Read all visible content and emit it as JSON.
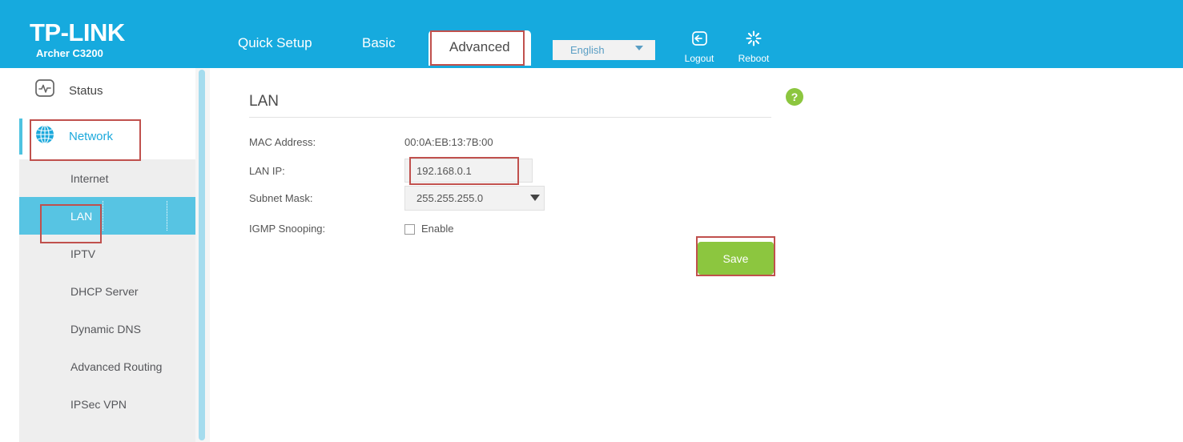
{
  "header": {
    "brand": "TP-LINK",
    "model": "Archer C3200",
    "tabs": [
      {
        "label": "Quick Setup",
        "active": false
      },
      {
        "label": "Basic",
        "active": false
      },
      {
        "label": "Advanced",
        "active": true
      }
    ],
    "language": {
      "selected": "English",
      "icon": "chevron-down-icon"
    },
    "actions": [
      {
        "label": "Logout",
        "icon": "logout-icon"
      },
      {
        "label": "Reboot",
        "icon": "reboot-icon"
      }
    ]
  },
  "sidebar": {
    "main_items": [
      {
        "label": "Status",
        "icon": "status-monitor-icon",
        "selected": false
      },
      {
        "label": "Network",
        "icon": "globe-icon",
        "selected": true
      }
    ],
    "sub_items": [
      {
        "label": "Internet",
        "active": false
      },
      {
        "label": "LAN",
        "active": true
      },
      {
        "label": "IPTV",
        "active": false
      },
      {
        "label": "DHCP Server",
        "active": false
      },
      {
        "label": "Dynamic DNS",
        "active": false
      },
      {
        "label": "Advanced Routing",
        "active": false
      },
      {
        "label": "IPSec VPN",
        "active": false
      }
    ]
  },
  "main": {
    "title": "LAN",
    "help_icon": "question-mark-icon",
    "help_label": "?",
    "fields": {
      "mac_label": "MAC Address:",
      "mac_value": "00:0A:EB:13:7B:00",
      "lanip_label": "LAN IP:",
      "lanip_value": "192.168.0.1",
      "subnet_label": "Subnet Mask:",
      "subnet_value": "255.255.255.0",
      "igmp_label": "IGMP Snooping:",
      "igmp_enable_label": "Enable",
      "igmp_checked": false
    },
    "save_label": "Save"
  },
  "colors": {
    "header_blue": "#16AADE",
    "accent_cyan": "#57C4E3",
    "green": "#8CC63F",
    "annotation_red": "#C0504D",
    "sidebar_grey": "#eeeeee"
  }
}
